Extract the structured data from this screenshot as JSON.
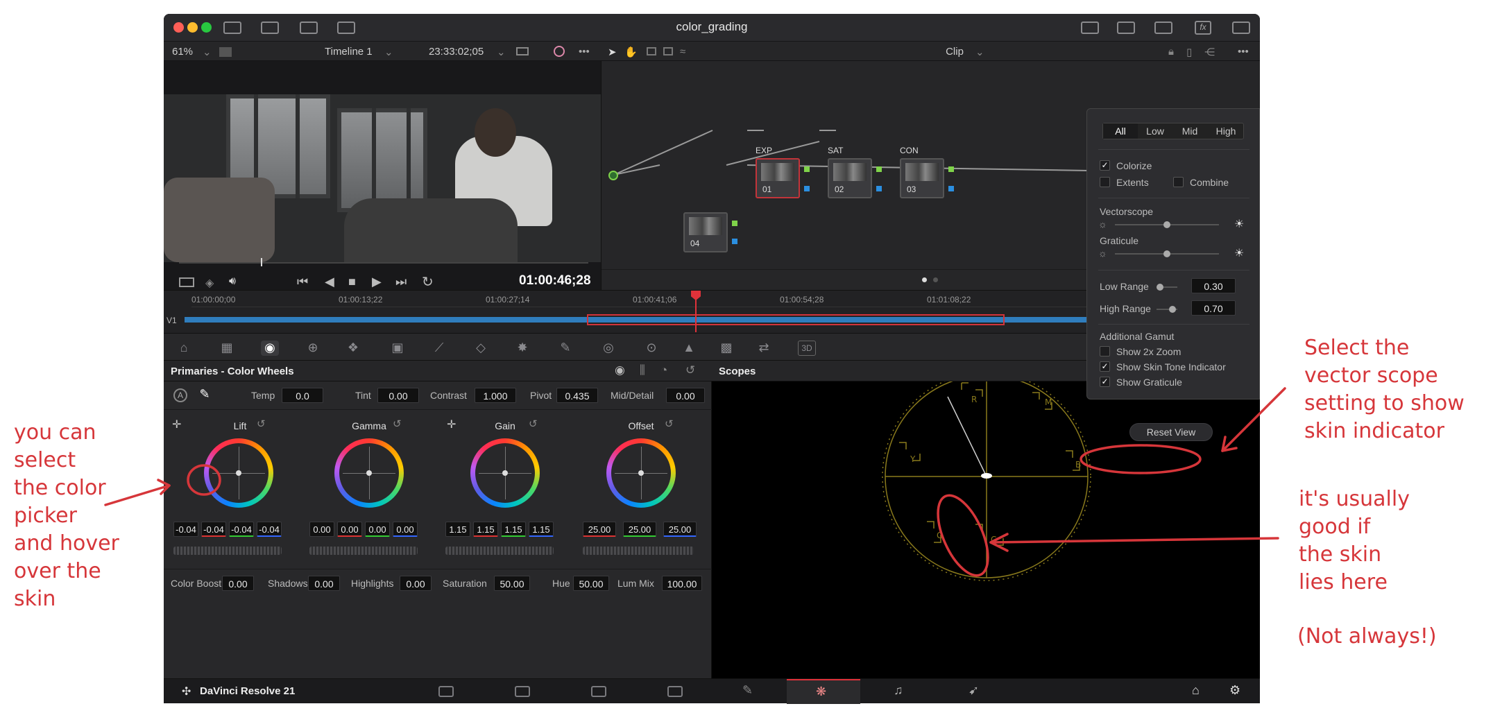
{
  "window": {
    "title": "color_grading"
  },
  "viewer": {
    "zoom": "61%",
    "timeline": "Timeline 1",
    "timecode": "23:33:02;05",
    "playhead_time": "01:00:46;28"
  },
  "node_editor": {
    "mode": "Clip",
    "nodes": [
      {
        "label": "EXP",
        "number": "01"
      },
      {
        "label": "SAT",
        "number": "02"
      },
      {
        "label": "CON",
        "number": "03"
      },
      {
        "label": "",
        "number": "04"
      }
    ]
  },
  "timeline": {
    "track": "V1",
    "ticks": [
      "01:00:00;00",
      "01:00:13;22",
      "01:00:27;14",
      "01:00:41;06",
      "01:00:54;28",
      "01:01:08;22"
    ]
  },
  "primaries": {
    "title": "Primaries - Color Wheels",
    "top_params": [
      {
        "label": "Temp",
        "value": "0.0"
      },
      {
        "label": "Tint",
        "value": "0.00"
      },
      {
        "label": "Contrast",
        "value": "1.000"
      },
      {
        "label": "Pivot",
        "value": "0.435"
      },
      {
        "label": "Mid/Detail",
        "value": "0.00"
      }
    ],
    "wheels": [
      {
        "name": "Lift",
        "values": [
          "-0.04",
          "-0.04",
          "-0.04",
          "-0.04"
        ]
      },
      {
        "name": "Gamma",
        "values": [
          "0.00",
          "0.00",
          "0.00",
          "0.00"
        ]
      },
      {
        "name": "Gain",
        "values": [
          "1.15",
          "1.15",
          "1.15",
          "1.15"
        ]
      },
      {
        "name": "Offset",
        "values": [
          "25.00",
          "25.00",
          "25.00"
        ]
      }
    ],
    "bottom_params": [
      {
        "label": "Color Boost",
        "value": "0.00"
      },
      {
        "label": "Shadows",
        "value": "0.00"
      },
      {
        "label": "Highlights",
        "value": "0.00"
      },
      {
        "label": "Saturation",
        "value": "50.00"
      },
      {
        "label": "Hue",
        "value": "50.00"
      },
      {
        "label": "Lum Mix",
        "value": "100.00"
      }
    ]
  },
  "scopes": {
    "title": "Scopes",
    "type": "Vectorscope",
    "targets": [
      "R",
      "M",
      "B",
      "C",
      "G",
      "Y"
    ]
  },
  "scope_settings": {
    "tabs": [
      "All",
      "Low",
      "Mid",
      "High"
    ],
    "active_tab": "All",
    "colorize": {
      "label": "Colorize",
      "checked": true
    },
    "extents": {
      "label": "Extents",
      "checked": false
    },
    "combine": {
      "label": "Combine",
      "checked": false
    },
    "vectorscope_label": "Vectorscope",
    "graticule_label": "Graticule",
    "low_range": {
      "label": "Low Range",
      "value": "0.30"
    },
    "high_range": {
      "label": "High Range",
      "value": "0.70"
    },
    "additional_gamut": "Additional Gamut",
    "show_2x_zoom": {
      "label": "Show 2x Zoom",
      "checked": false
    },
    "show_skin_tone": {
      "label": "Show Skin Tone Indicator",
      "checked": true
    },
    "show_graticule": {
      "label": "Show Graticule",
      "checked": true
    },
    "reset_view": "Reset View"
  },
  "footer": {
    "brand": "DaVinci Resolve 21"
  },
  "annotations": {
    "left": [
      "you can",
      "select",
      "the color",
      "picker",
      "and hover",
      "over the",
      "skin"
    ],
    "right_top": [
      "Select the",
      "vector scope",
      "setting to show",
      "skin indicator"
    ],
    "right_mid": [
      "it's usually",
      "good if",
      "the skin",
      "lies here"
    ],
    "right_note": "(Not always!)"
  },
  "colors": {
    "annotation": "#d6363a",
    "accent_red": "#e0323a",
    "scope_graticule": "#8a7a1c"
  }
}
